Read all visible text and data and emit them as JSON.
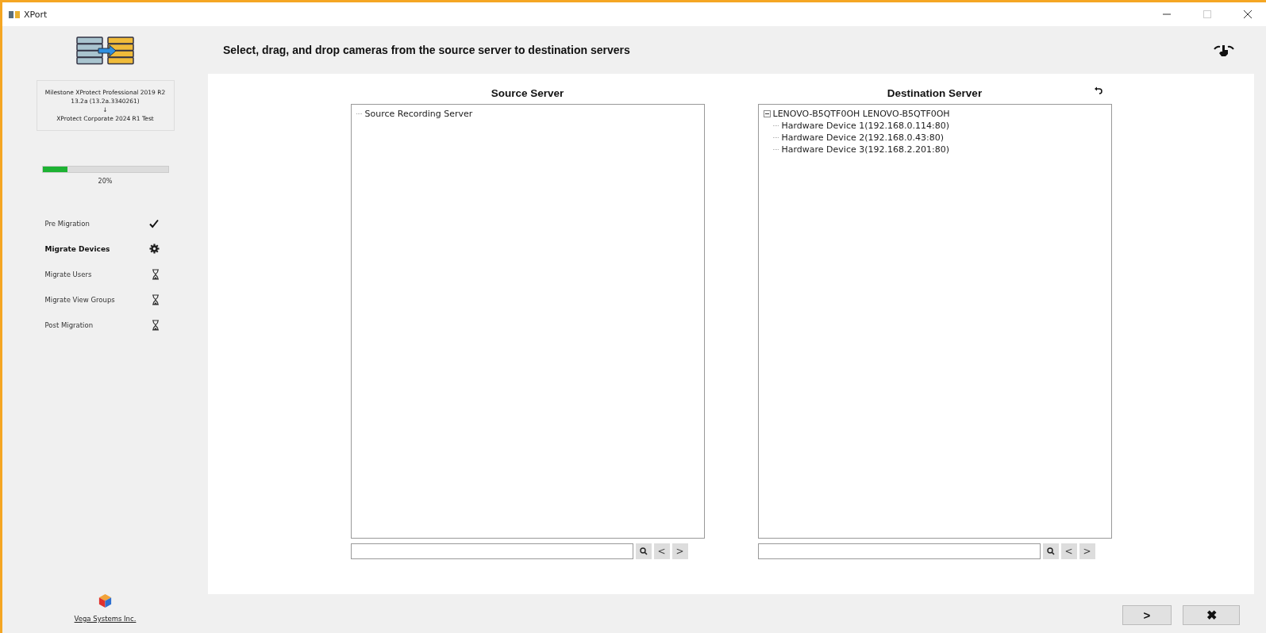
{
  "window": {
    "title": "XPort"
  },
  "sidebar": {
    "migration_summary": {
      "source": "Milestone XProtect Professional 2019 R2 13.2a (13.2a.3340261)",
      "arrow": "↓",
      "destination": "XProtect Corporate 2024 R1 Test"
    },
    "progress": {
      "level": 0.2,
      "reading": "20%"
    },
    "steps": [
      {
        "label": "Pre Migration",
        "kind": "done"
      },
      {
        "label": "Migrate Devices",
        "kind": "active"
      },
      {
        "label": "Migrate Users",
        "kind": "pending"
      },
      {
        "label": "Migrate View Groups",
        "kind": "pending"
      },
      {
        "label": "Post Migration",
        "kind": "pending"
      }
    ],
    "company_link": "Vega Systems Inc."
  },
  "instruction": "Select, drag, and drop cameras from the source server to destination servers",
  "panels": [
    {
      "title": "Source Server",
      "tree": [
        {
          "label": "Source Recording Server"
        }
      ],
      "search": {
        "prev": "<",
        "next": ">"
      }
    },
    {
      "title": "Destination Server",
      "tree": [
        {
          "label": "LENOVO-B5QTF0OH LENOVO-B5QTF0OH",
          "expanded": true,
          "children": [
            {
              "label": "Hardware Device 1(192.168.0.114:80)"
            },
            {
              "label": "Hardware Device 2(192.168.0.43:80)"
            },
            {
              "label": "Hardware Device 3(192.168.2.201:80)"
            }
          ]
        }
      ],
      "search": {
        "prev": "<",
        "next": ">"
      }
    }
  ],
  "footer_buttons": [
    {
      "kind": "next",
      "label": ">"
    },
    {
      "kind": "cancel",
      "label": "✖"
    }
  ]
}
